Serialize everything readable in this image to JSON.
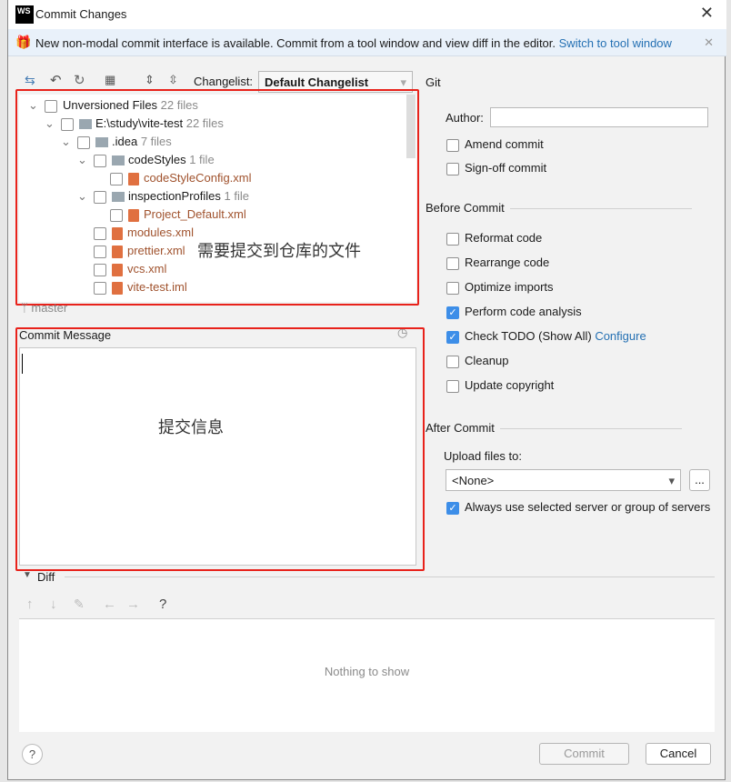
{
  "window": {
    "title": "Commit Changes",
    "logo": "WS"
  },
  "banner": {
    "text": "New non-modal commit interface is available. Commit from a tool window and view diff in the editor.",
    "link": "Switch to tool window"
  },
  "toolbar": {
    "changelist_label": "Changelist:",
    "changelist_value": "Default Changelist"
  },
  "tree": [
    {
      "label": "Unversioned Files",
      "count": "22 files",
      "type": "group"
    },
    {
      "label": "E:\\study\\vite-test",
      "count": "22 files",
      "type": "folder"
    },
    {
      "label": ".idea",
      "count": "7 files",
      "type": "folder"
    },
    {
      "label": "codeStyles",
      "count": "1 file",
      "type": "folder"
    },
    {
      "label": "codeStyleConfig.xml",
      "count": "",
      "type": "file"
    },
    {
      "label": "inspectionProfiles",
      "count": "1 file",
      "type": "folder"
    },
    {
      "label": "Project_Default.xml",
      "count": "",
      "type": "file"
    },
    {
      "label": "modules.xml",
      "count": "",
      "type": "file"
    },
    {
      "label": "prettier.xml",
      "count": "",
      "type": "file"
    },
    {
      "label": "vcs.xml",
      "count": "",
      "type": "file"
    },
    {
      "label": "vite-test.iml",
      "count": "",
      "type": "file"
    }
  ],
  "branch": "master",
  "annotations": {
    "files": "需要提交到仓库的文件",
    "message": "提交信息"
  },
  "commit_message": {
    "label": "Commit Message",
    "value": ""
  },
  "git": {
    "header": "Git",
    "author_label": "Author:",
    "author_value": "",
    "amend": "Amend commit",
    "signoff": "Sign-off commit"
  },
  "before_commit": {
    "header": "Before Commit",
    "options": [
      {
        "label": "Reformat code",
        "checked": false
      },
      {
        "label": "Rearrange code",
        "checked": false
      },
      {
        "label": "Optimize imports",
        "checked": false
      },
      {
        "label": "Perform code analysis",
        "checked": true
      },
      {
        "label": "Check TODO (Show All)",
        "checked": true
      },
      {
        "label": "Cleanup",
        "checked": false
      },
      {
        "label": "Update copyright",
        "checked": false
      }
    ],
    "configure_link": "Configure"
  },
  "after_commit": {
    "header": "After Commit",
    "upload_label": "Upload files to:",
    "upload_value": "<None>",
    "browse": "...",
    "always_use": "Always use selected server or group of servers"
  },
  "diff": {
    "header": "Diff",
    "empty": "Nothing to show"
  },
  "buttons": {
    "help": "?",
    "commit": "Commit",
    "cancel": "Cancel"
  },
  "colors": {
    "accent": "#3d8ee8",
    "annotation_red": "#e8221b",
    "link": "#2470b3"
  }
}
